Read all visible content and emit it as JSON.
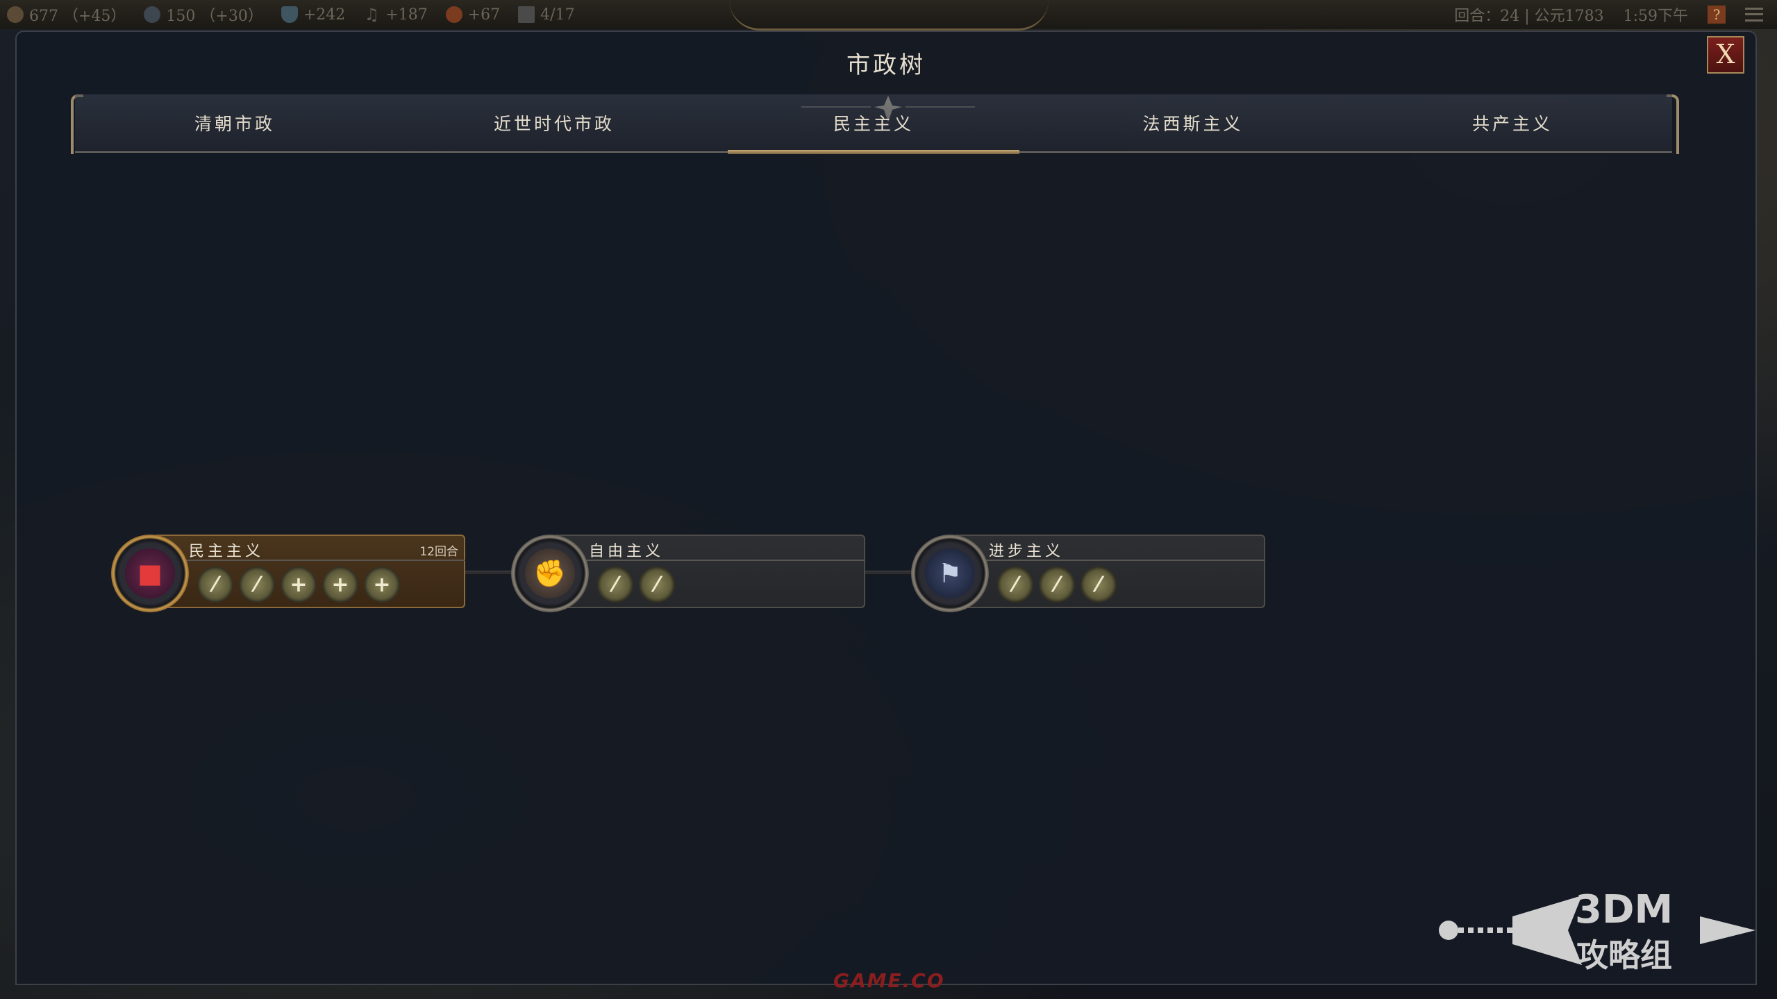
{
  "topbar": {
    "resources": [
      {
        "icon": "food-icon",
        "text": "677 （+45）"
      },
      {
        "icon": "globe-icon",
        "text": "150 （+30）"
      },
      {
        "icon": "flask-icon",
        "text": "+242"
      },
      {
        "icon": "music-icon",
        "text": "+187"
      },
      {
        "icon": "gold-icon",
        "text": "+67"
      },
      {
        "icon": "city-icon",
        "text": "4/17"
      }
    ],
    "turn_info": "回合：24 | 公元1783",
    "clock": "1:59下午",
    "help_label": "?"
  },
  "modal": {
    "title": "市政树",
    "close_label": "X"
  },
  "tabs": [
    {
      "label": "清朝市政",
      "active": false
    },
    {
      "label": "近世时代市政",
      "active": false
    },
    {
      "label": "民主主义",
      "active": true
    },
    {
      "label": "法西斯主义",
      "active": false
    },
    {
      "label": "共产主义",
      "active": false
    }
  ],
  "nodes": [
    {
      "name": "民主主义",
      "turns": "12回合",
      "icon": "ballot-box-icon",
      "state": "researched",
      "unlocks": [
        "quill-icon",
        "quill-icon",
        "plus-icon",
        "plus-icon",
        "plus-icon"
      ]
    },
    {
      "name": "自由主义",
      "turns": "",
      "icon": "raised-fist-icon",
      "state": "locked",
      "unlocks": [
        "quill-icon",
        "quill-icon"
      ]
    },
    {
      "name": "进步主义",
      "turns": "",
      "icon": "flag-icon",
      "state": "locked",
      "unlocks": [
        "quill-icon",
        "quill-icon",
        "quill-icon"
      ]
    }
  ],
  "watermarks": {
    "brand": "3DM",
    "brand_sub": "攻略组",
    "bottom": "GAME.CO"
  },
  "colors": {
    "accent_gold": "#c5a877",
    "close_red": "#7a1f1c",
    "researched_card": "#4a351d"
  }
}
